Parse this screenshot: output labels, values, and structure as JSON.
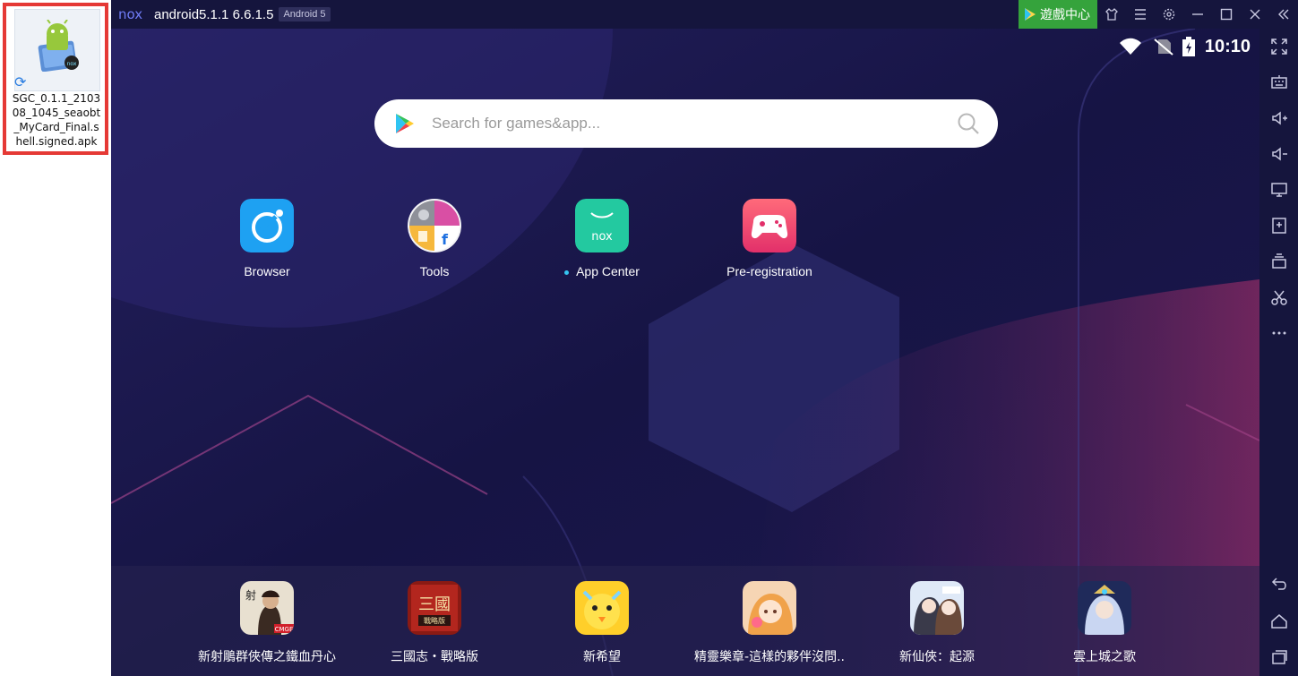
{
  "desktop": {
    "file_name": "SGC_0.1.1_210308_1045_seaobt_MyCard_Final.shell.signed.apk",
    "file_icon": "apk-file-icon",
    "file_badge_icon": "nox-badge-icon",
    "sync_icon": "sync-icon"
  },
  "colors": {
    "highlight": "#e53935",
    "game_center": "#35a33c",
    "titlebar": "#15153d",
    "screen_bg": "#1a1846"
  },
  "titlebar": {
    "app_logo": "nox",
    "title": "android5.1.1 6.6.1.5",
    "badge": "Android 5",
    "game_center_label": "遊戲中心",
    "buttons": [
      "skin-icon",
      "menu-icon",
      "settings-icon",
      "minimize-icon",
      "maximize-icon",
      "close-icon",
      "collapse-icon"
    ]
  },
  "statusbar": {
    "time": "10:10",
    "icons": [
      "wifi-icon",
      "no-sim-icon",
      "battery-icon"
    ]
  },
  "search": {
    "placeholder": "Search for games&app..."
  },
  "apps": [
    {
      "label": "Browser",
      "icon": "browser-icon"
    },
    {
      "label": "Tools",
      "icon": "tools-icon"
    },
    {
      "label": "App Center",
      "icon": "app-center-icon"
    },
    {
      "label": "Pre-registration",
      "icon": "pre-registration-icon"
    }
  ],
  "dock": [
    {
      "label": "新射鵰群俠傳之鐵血丹心"
    },
    {
      "label": "三國志・戰略版"
    },
    {
      "label": "新希望"
    },
    {
      "label": "精靈樂章-這樣的夥伴沒問.."
    },
    {
      "label": "新仙俠：起源"
    },
    {
      "label": "雲上城之歌"
    }
  ],
  "sidebar": {
    "buttons": [
      "fullscreen-icon",
      "keyboard-icon",
      "volume-up-icon",
      "volume-down-icon",
      "screen-icon",
      "add-apk-icon",
      "multi-instance-icon",
      "screenshot-icon",
      "more-icon",
      "back-icon",
      "home-icon",
      "recent-apps-icon"
    ]
  }
}
